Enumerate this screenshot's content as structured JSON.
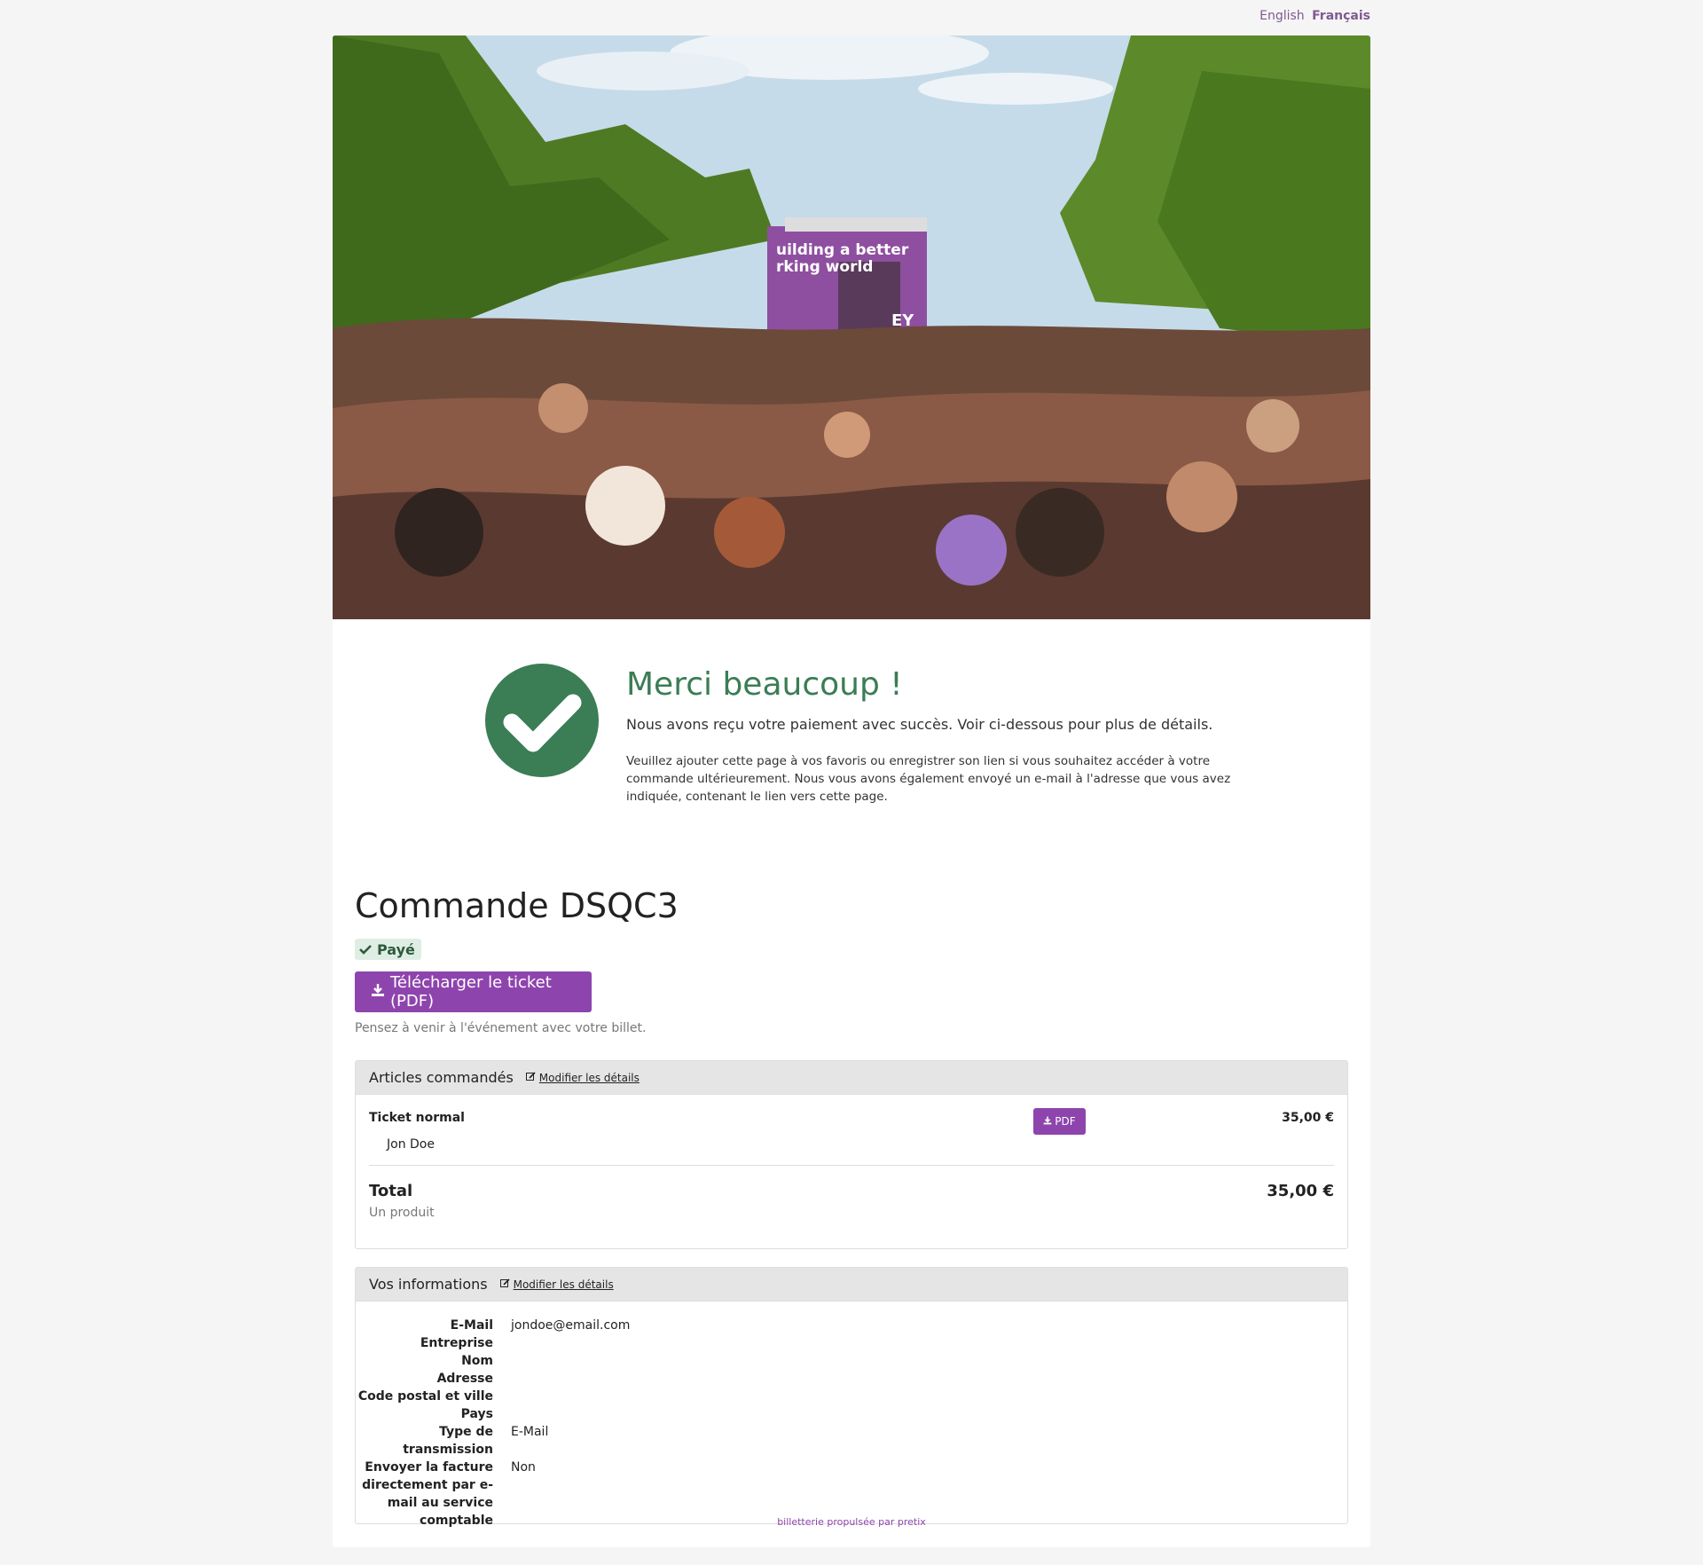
{
  "lang": {
    "english": "English",
    "francais": "Français"
  },
  "hero": {
    "alt": "crowd-parade-photo",
    "truck_text_1": "uilding a better",
    "truck_text_2": "rking world",
    "logo_text": "EY"
  },
  "thanks": {
    "title": "Merci beaucoup !",
    "subtitle": "Nous avons reçu votre paiement avec succès. Voir ci-dessous pour plus de détails.",
    "note": "Veuillez ajouter cette page à vos favoris ou enregistrer son lien si vous souhaitez accéder à votre commande ultérieurement. Nous vous avons également envoyé un e-mail à l'adresse que vous avez indiquée, contenant le lien vers cette page."
  },
  "order": {
    "title": "Commande DSQC3",
    "status": "Payé",
    "download_label": "Télécharger le ticket (PDF)",
    "hint": "Pensez à venir à l'événement avec votre billet."
  },
  "articles": {
    "heading": "Articles commandés",
    "edit_label": "Modifier les détails",
    "items": [
      {
        "name": "Ticket normal",
        "attendee": "Jon Doe",
        "pdf_label": "PDF",
        "price": "35,00 €"
      }
    ],
    "total_label": "Total",
    "total_sub": "Un produit",
    "total_value": "35,00 €"
  },
  "info": {
    "heading": "Vos informations",
    "edit_label": "Modifier les détails",
    "rows": [
      {
        "key": "E-Mail",
        "value": "jondoe@email.com"
      },
      {
        "key": "Entreprise",
        "value": ""
      },
      {
        "key": "Nom",
        "value": ""
      },
      {
        "key": "Adresse",
        "value": ""
      },
      {
        "key": "Code postal et ville",
        "value": ""
      },
      {
        "key": "Pays",
        "value": ""
      },
      {
        "key": "Type de transmission",
        "value": "E-Mail"
      },
      {
        "key": "Envoyer la facture directement par e-mail au service comptable",
        "value": "Non"
      }
    ]
  },
  "footer": {
    "text": "billetterie propulsée par pretix"
  },
  "colors": {
    "accent": "#8e44ad",
    "success": "#3b7d55",
    "success_bg": "#dfeee4",
    "panel_head": "#e5e5e5"
  },
  "icons": {
    "check": "check-icon",
    "download": "download-icon",
    "edit": "edit-icon"
  }
}
